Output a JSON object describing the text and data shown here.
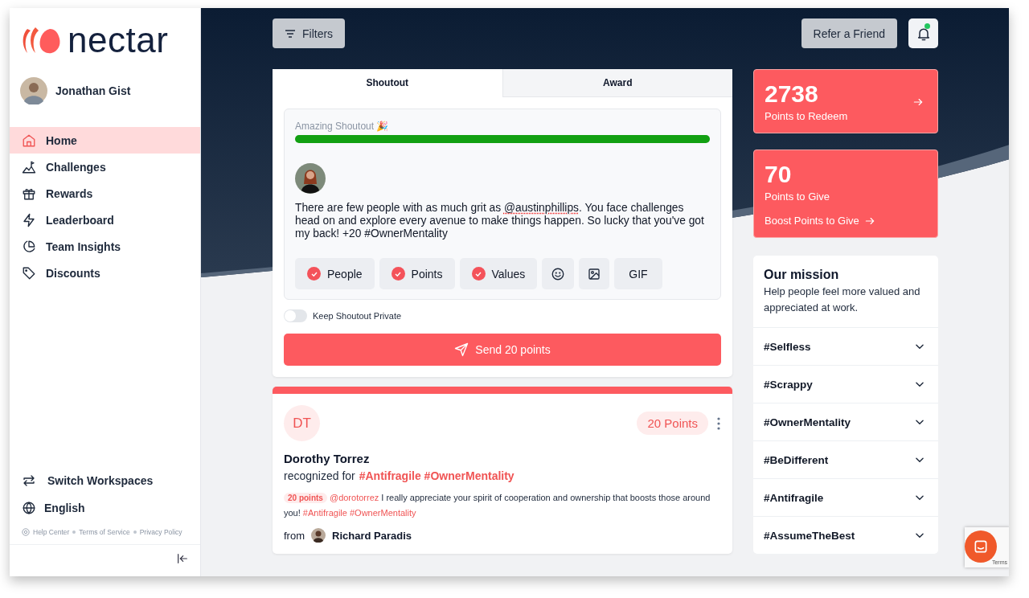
{
  "brand": {
    "name": "nectar"
  },
  "user": {
    "name": "Jonathan Gist"
  },
  "nav": [
    {
      "kind": "home",
      "label": "Home",
      "selected": true
    },
    {
      "kind": "challenges",
      "label": "Challenges",
      "selected": false
    },
    {
      "kind": "rewards",
      "label": "Rewards",
      "selected": false
    },
    {
      "kind": "leaderboard",
      "label": "Leaderboard",
      "selected": false
    },
    {
      "kind": "insights",
      "label": "Team Insights",
      "selected": false
    },
    {
      "kind": "discounts",
      "label": "Discounts",
      "selected": false
    }
  ],
  "sidebar_bottom": [
    {
      "kind": "switch",
      "label": "Switch Workspaces"
    },
    {
      "kind": "language",
      "label": "English"
    }
  ],
  "footer_links": [
    "Help Center",
    "Terms of Service",
    "Privacy Policy"
  ],
  "topbar": {
    "filters": "Filters",
    "refer": "Refer a Friend",
    "notification_dot": true
  },
  "tabs": [
    {
      "label": "Shoutout",
      "selected": true
    },
    {
      "label": "Award",
      "selected": false
    }
  ],
  "composer": {
    "quality_label": "Amazing Shoutout 🎉",
    "level": 1,
    "message": [
      {
        "kind": "text",
        "text": "There are few people with as much grit as "
      },
      {
        "kind": "misspelled",
        "text": "@austinphillips"
      },
      {
        "kind": "text",
        "text": ". You face challenges head on and explore every avenue to make things happen. So lucky that you've got my back! +20 #OwnerMentality"
      }
    ],
    "chips": [
      {
        "kind": "check",
        "label": "People",
        "checked": true
      },
      {
        "kind": "check",
        "label": "Points",
        "checked": true
      },
      {
        "kind": "check",
        "label": "Values",
        "checked": true
      },
      {
        "kind": "emoji"
      },
      {
        "kind": "image"
      },
      {
        "kind": "text",
        "label": "GIF"
      }
    ],
    "private_toggle": {
      "label": "Keep Shoutout Private",
      "on": false
    },
    "send": "Send 20 points"
  },
  "post": {
    "initials": "DT",
    "points": "20 Points",
    "name": "Dorothy Torrez",
    "recognized_prefix": "recognized for",
    "recognized_tags": "#Antifragile #OwnerMentality",
    "message": [
      {
        "kind": "pill",
        "text": "20 points"
      },
      {
        "kind": "mention",
        "text": "@dorotorrez"
      },
      {
        "kind": "text",
        "text": "I really appreciate your spirit of cooperation and ownership that boosts those around you!"
      },
      {
        "kind": "tag",
        "text": "#Antifragile"
      },
      {
        "kind": "tag",
        "text": "#OwnerMentality"
      }
    ],
    "from_label": "from",
    "from_name": "Richard Paradis"
  },
  "stats": [
    {
      "value": "2738",
      "label": "Points to Redeem"
    },
    {
      "value": "70",
      "label": "Points to Give",
      "link": "Boost Points to Give"
    }
  ],
  "mission": {
    "title": "Our mission",
    "text": "Help people feel more valued and appreciated at work.",
    "values": [
      {
        "label": "#Selfless",
        "expanded": false
      },
      {
        "label": "#Scrappy",
        "expanded": false
      },
      {
        "label": "#OwnerMentality",
        "expanded": false
      },
      {
        "label": "#BeDifferent",
        "expanded": false
      },
      {
        "label": "#Antifragile",
        "expanded": false
      },
      {
        "label": "#AssumeTheBest",
        "expanded": false
      }
    ]
  },
  "recaptcha": {
    "text": "Terms"
  }
}
